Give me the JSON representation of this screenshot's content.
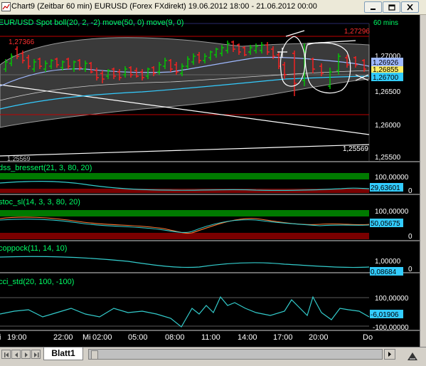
{
  "window": {
    "title": "Chart9 (Zeitbar 60 min)  EURUSD (Forex FXdirekt) 19.06.2012 18:00 - 21.06.2012 00:00",
    "minimize_icon": "minimize-icon",
    "restore_icon": "restore-icon",
    "close_icon": "close-icon"
  },
  "chart": {
    "main_legend": "EUR/USD Spot boll(20, 2, -2) move(50, 0) move(9, 0)",
    "timeframe": "60 mins",
    "price_labels": {
      "top_red": "1,27296",
      "left_red": "1,27366",
      "p_127000": "1,27000",
      "boxed_blue": "1,26926",
      "boxed_yellow": "1,26855",
      "boxed_cyan": "1,26700",
      "p_126500": "1,26500",
      "p_126000": "1,26000",
      "lower_white": "1,25569",
      "left_lower": "1,25569",
      "p_125500": "1,25500"
    },
    "indicators": [
      {
        "legend": "dss_bressert(21, 3, 80, 20)",
        "top": "100,00000",
        "value": "29,63601",
        "bottom": "0"
      },
      {
        "legend": "stoc_sl(14, 3, 3, 80, 20)",
        "top": "100,00000",
        "value": "50,05675",
        "bottom": "0"
      },
      {
        "legend": "coppock(11, 14, 10)",
        "top": "1,00000",
        "value": "0,08684",
        "bottom": "0"
      },
      {
        "legend": "cci_std(20, 100, -100)",
        "top": "100,00000",
        "value": "-6,01906",
        "bottom": "-100,00000"
      }
    ],
    "time_axis": [
      "19:00",
      "22:00",
      "Mi",
      "02:00",
      "05:00",
      "08:00",
      "11:00",
      "14:00",
      "17:00",
      "20:00",
      "Do"
    ],
    "time_axis_left_fragment": "i",
    "colors": {
      "background": "#000000",
      "up_bar": "#00cc00",
      "down_bar": "#ff2020",
      "bollinger_band": "#8c8c8c",
      "ma50": "#33ccff",
      "ma9": "#9fb9ff",
      "overbought_zone": "#007a00",
      "oversold_zone": "#7a0000",
      "indicator_line": "#33cccc"
    }
  },
  "sheet": {
    "tab_label": "Blatt1"
  }
}
